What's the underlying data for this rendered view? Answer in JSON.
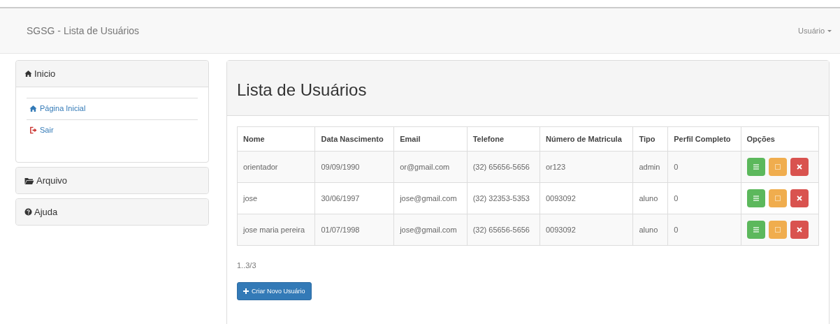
{
  "navbar": {
    "brand": "SGSG - Lista de Usuários",
    "user_menu": "Usuário"
  },
  "sidebar": {
    "panels": [
      {
        "title": "Inicio",
        "expanded": true,
        "items": [
          {
            "label": "Página Inicial"
          },
          {
            "label": "Sair"
          }
        ]
      },
      {
        "title": "Arquivo",
        "expanded": false
      },
      {
        "title": "Ajuda",
        "expanded": false
      }
    ]
  },
  "main": {
    "title": "Lista de Usuários",
    "table": {
      "columns": [
        "Nome",
        "Data Nascimento",
        "Email",
        "Telefone",
        "Número de Matricula",
        "Tipo",
        "Perfil Completo",
        "Opções"
      ],
      "rows": [
        [
          "orientador",
          "09/09/1990",
          "or@gmail.com",
          "(32) 65656-5656",
          "or123",
          "admin",
          "0"
        ],
        [
          "jose",
          "30/06/1997",
          "jose@gmail.com",
          "(32) 32353-5353",
          "0093092",
          "aluno",
          "0"
        ],
        [
          "jose maria pereira",
          "01/07/1998",
          "jose@gmail.com",
          "(32) 65656-5656",
          "0093092",
          "aluno",
          "0"
        ]
      ]
    },
    "pagination": "1..3/3",
    "create_button": "Criar Novo Usuário"
  }
}
